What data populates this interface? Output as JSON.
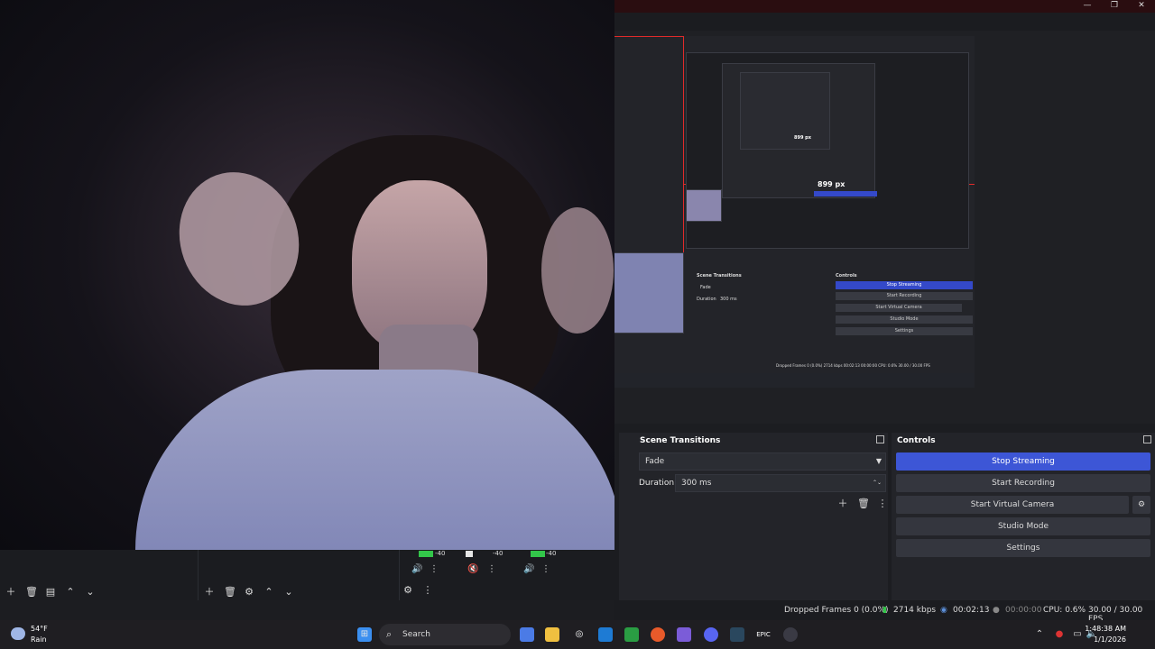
{
  "window": {
    "controls": [
      "—",
      "❐",
      "✕"
    ]
  },
  "preview": {
    "nested_label": "899 px",
    "nested_inner_label": "899 px",
    "nested_scene_transitions": "Scene Transitions",
    "nested_controls": "Controls",
    "nested_fade": "Fade",
    "nested_duration": "Duration",
    "nested_duration_value": "300 ms",
    "nested_buttons": [
      "Stop Streaming",
      "Start Recording",
      "Start Virtual Camera",
      "Studio Mode",
      "Settings"
    ],
    "nested_status": "Dropped Frames 0 (0.0%)   2714 kbps   00:02:13   00:00:00   CPU: 0.6%   30.00 / 30.00 FPS"
  },
  "mixer": {
    "ch1_db": "-40",
    "ch2_db": "-40",
    "ch3_db": "-40"
  },
  "scene_transitions": {
    "title": "Scene Transitions",
    "transition": "Fade",
    "duration_label": "Duration",
    "duration_value": "300 ms"
  },
  "controls": {
    "title": "Controls",
    "stop_streaming": "Stop Streaming",
    "start_recording": "Start Recording",
    "start_virtual_camera": "Start Virtual Camera",
    "studio_mode": "Studio Mode",
    "settings": "Settings"
  },
  "status": {
    "dropped_frames": "Dropped Frames 0 (0.0%)",
    "bitrate": "2714 kbps",
    "stream_time": "00:02:13",
    "record_time": "00:00:00",
    "cpu": "CPU: 0.6%",
    "fps": "30.00 / 30.00 FPS"
  },
  "taskbar": {
    "weather_temp": "54°F",
    "weather_desc": "Rain",
    "search": "Search",
    "time": "1:48:38 AM",
    "date": "1/1/2026"
  },
  "colors": {
    "accent": "#3d56d6",
    "red_guide": "#e02a2a"
  }
}
